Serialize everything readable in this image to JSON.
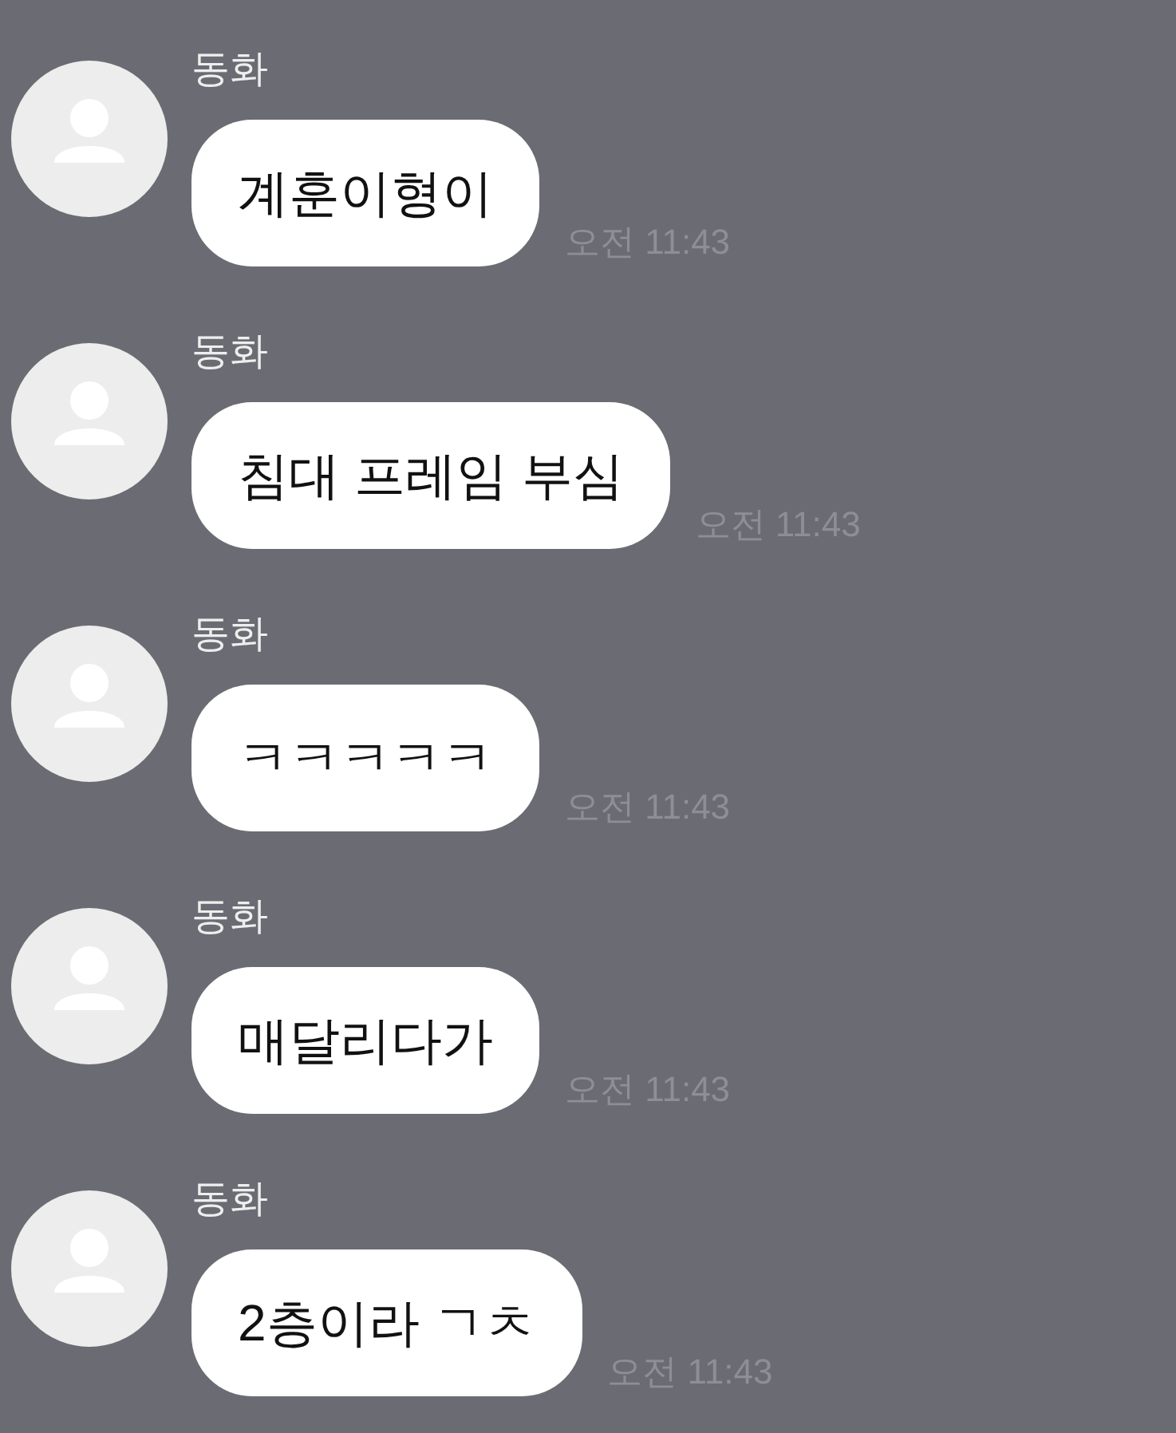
{
  "messages": [
    {
      "sender": "동화",
      "text": "계훈이형이",
      "time": "오전 11:43"
    },
    {
      "sender": "동화",
      "text": "침대 프레임 부심",
      "time": "오전 11:43"
    },
    {
      "sender": "동화",
      "text": "ㅋㅋㅋㅋㅋ",
      "time": "오전 11:43"
    },
    {
      "sender": "동화",
      "text": "매달리다가",
      "time": "오전 11:43"
    },
    {
      "sender": "동화",
      "text": "2층이라 ㄱㅊ",
      "time": "오전 11:43"
    }
  ]
}
